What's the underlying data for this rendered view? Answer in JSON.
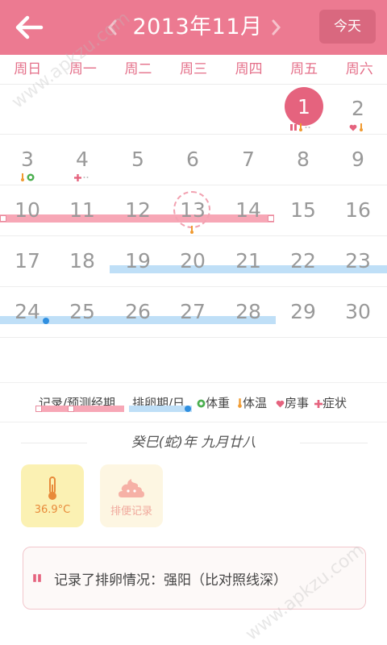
{
  "header": {
    "month_title": "2013年11月",
    "today_label": "今天"
  },
  "weekdays": [
    "周日",
    "周一",
    "周二",
    "周三",
    "周四",
    "周五",
    "周六"
  ],
  "days": {
    "d1": "1",
    "d2": "2",
    "d3": "3",
    "d4": "4",
    "d5": "5",
    "d6": "6",
    "d7": "7",
    "d8": "8",
    "d9": "9",
    "d10": "10",
    "d11": "11",
    "d12": "12",
    "d13": "13",
    "d14": "14",
    "d15": "15",
    "d16": "16",
    "d17": "17",
    "d18": "18",
    "d19": "19",
    "d20": "20",
    "d21": "21",
    "d22": "22",
    "d23": "23",
    "d24": "24",
    "d25": "25",
    "d26": "26",
    "d27": "27",
    "d28": "28",
    "d29": "29",
    "d30": "30"
  },
  "selected_day": "1",
  "legend": {
    "period": "记录/预测经期",
    "ovulation": "排卵期/日",
    "weight": "体重",
    "temperature": "体温",
    "intimacy": "房事",
    "symptom": "症状"
  },
  "lunar_date": "癸巳(蛇)年 九月廿八",
  "cards": {
    "temperature_value": "36.9°C",
    "stool_label": "排便记录"
  },
  "record_text": "记录了排卵情况：强阳（比对照线深）",
  "watermark": [
    "www.apkzu.com",
    "www.apkzu.com"
  ],
  "colors": {
    "header": "#ec7a91",
    "accent": "#e5637e",
    "period_bar": "#f7a7b6",
    "ovulation_bar": "#bfdff7",
    "ovulation_dot": "#2f8fe0",
    "weight": "#4caf50",
    "temperature": "#f09a30"
  }
}
